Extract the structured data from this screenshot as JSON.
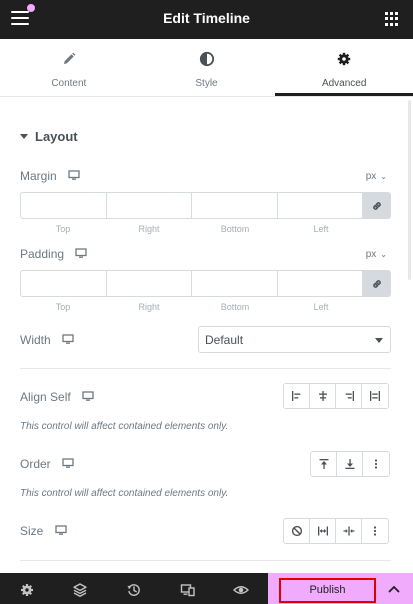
{
  "header": {
    "title": "Edit Timeline",
    "menu_icon": "hamburger-icon",
    "apps_icon": "grid-icon",
    "notification_color": "#f0abfc"
  },
  "tabs": [
    {
      "label": "Content",
      "icon": "pencil-icon"
    },
    {
      "label": "Style",
      "icon": "half-circle-icon"
    },
    {
      "label": "Advanced",
      "icon": "gear-icon",
      "active": true
    }
  ],
  "section": {
    "title": "Layout"
  },
  "margin": {
    "label": "Margin",
    "unit": "px",
    "fields": [
      "Top",
      "Right",
      "Bottom",
      "Left"
    ],
    "values": [
      "",
      "",
      "",
      ""
    ]
  },
  "padding": {
    "label": "Padding",
    "unit": "px",
    "fields": [
      "Top",
      "Right",
      "Bottom",
      "Left"
    ],
    "values": [
      "",
      "",
      "",
      ""
    ]
  },
  "width": {
    "label": "Width",
    "value": "Default"
  },
  "align_self": {
    "label": "Align Self",
    "note": "This control will affect contained elements only."
  },
  "order": {
    "label": "Order",
    "note": "This control will affect contained elements only."
  },
  "size": {
    "label": "Size"
  },
  "footer": {
    "publish_label": "Publish",
    "publish_bg": "#f0abfc",
    "highlight_color": "#e00000"
  }
}
